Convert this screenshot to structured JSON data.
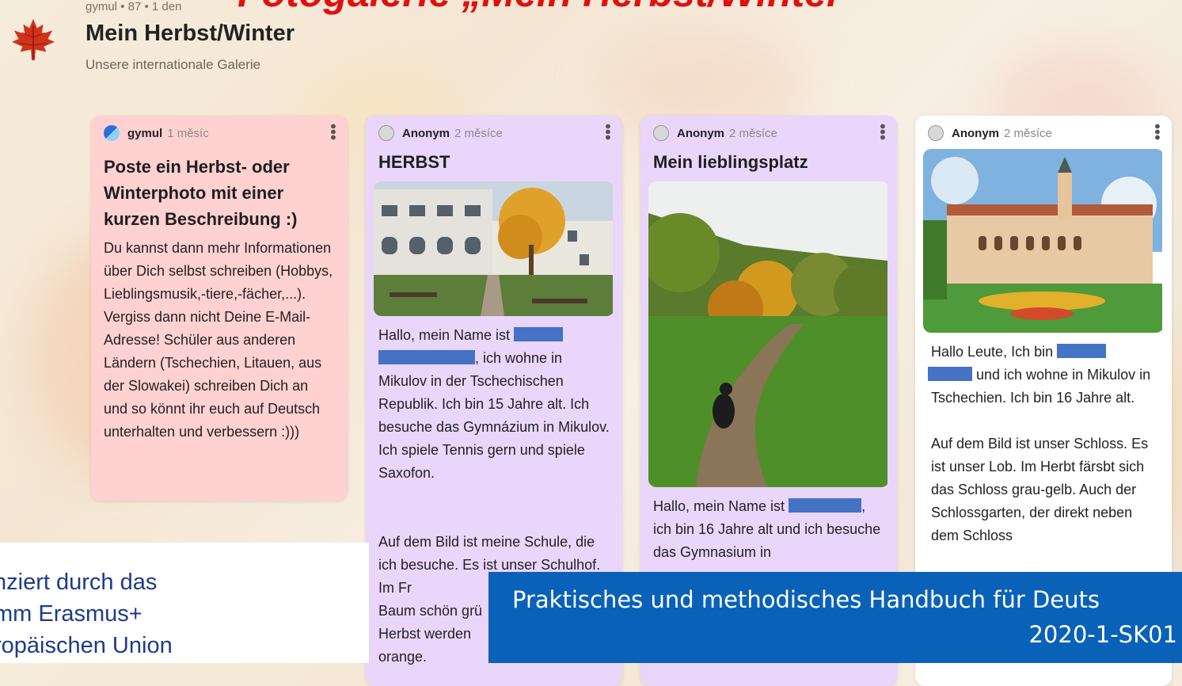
{
  "slide": {
    "title": "Fotogalerie „Mein Herbst/Winter“",
    "footer_line1": "Praktisches und methodisches Handbuch für Deuts",
    "footer_line2": "2020-1-SK01",
    "logo_lines": [
      "nziert durch das",
      "mm Erasmus+",
      "ropäischen Union"
    ],
    "title_color": "#e01010",
    "footer_color": "#0a61b8"
  },
  "pad": {
    "meta": "gymul • 87 • 1 den",
    "title": "Mein Herbst/Winter",
    "subtitle": "Unsere internationale Galerie",
    "icon": "maple-leaf-icon"
  },
  "cards": [
    {
      "author": "gymul",
      "time": "1 měsíc",
      "title": "Poste ein Herbst- oder Winterphoto mit einer kurzen Beschreibung :)",
      "body": "Du kannst dann mehr Informationen über Dich selbst schreiben (Hobbys, Lieblingsmusik,-tiere,-fächer,...). Vergiss dann nicht Deine E-Mail-Adresse! Schüler aus anderen Ländern (Tschechien, Litauen, aus der Slowakei) schreiben Dich an und so könnt ihr euch auf Deutsch unterhalten und verbessern :)))"
    },
    {
      "author": "Anonym",
      "time": "2 měsíce",
      "title": "HERBST",
      "body_a": "Hallo, mein Name ist",
      "body_b": ", ich wohne in Mikulov in der Tschechischen Republik. Ich bin 15 Jahre alt. Ich besuche das Gymnázium in Mikulov. Ich spiele Tennis gern und spiele Saxofon.",
      "body_c": "Auf dem Bild ist meine  Schule, die  ich besuche. Es ist unser Schulhof. Im Fr",
      "body_d": "Baum schön grü",
      "body_e": "Herbst werden",
      "body_f": "orange."
    },
    {
      "author": "Anonym",
      "time": "2 měsíce",
      "title": "Mein lieblingsplatz",
      "body_a": "Hallo, mein Name ist",
      "body_b": "ich bin 16 Jahre alt und ich besuche das Gymnasium in"
    },
    {
      "author": "Anonym",
      "time": "2 měsíce",
      "body_a": "Hallo Leute, Ich bin",
      "body_b": " und ich wohne in Mikulov in Tschechien. Ich bin 16 Jahre alt.",
      "body_c": "Auf dem Bild ist unser Schloss. Es ist unser Lob. Im Herbt färsbt sich das Schloss  grau-gelb. Auch der Schlossgarten, der direkt neben dem Schloss"
    }
  ]
}
